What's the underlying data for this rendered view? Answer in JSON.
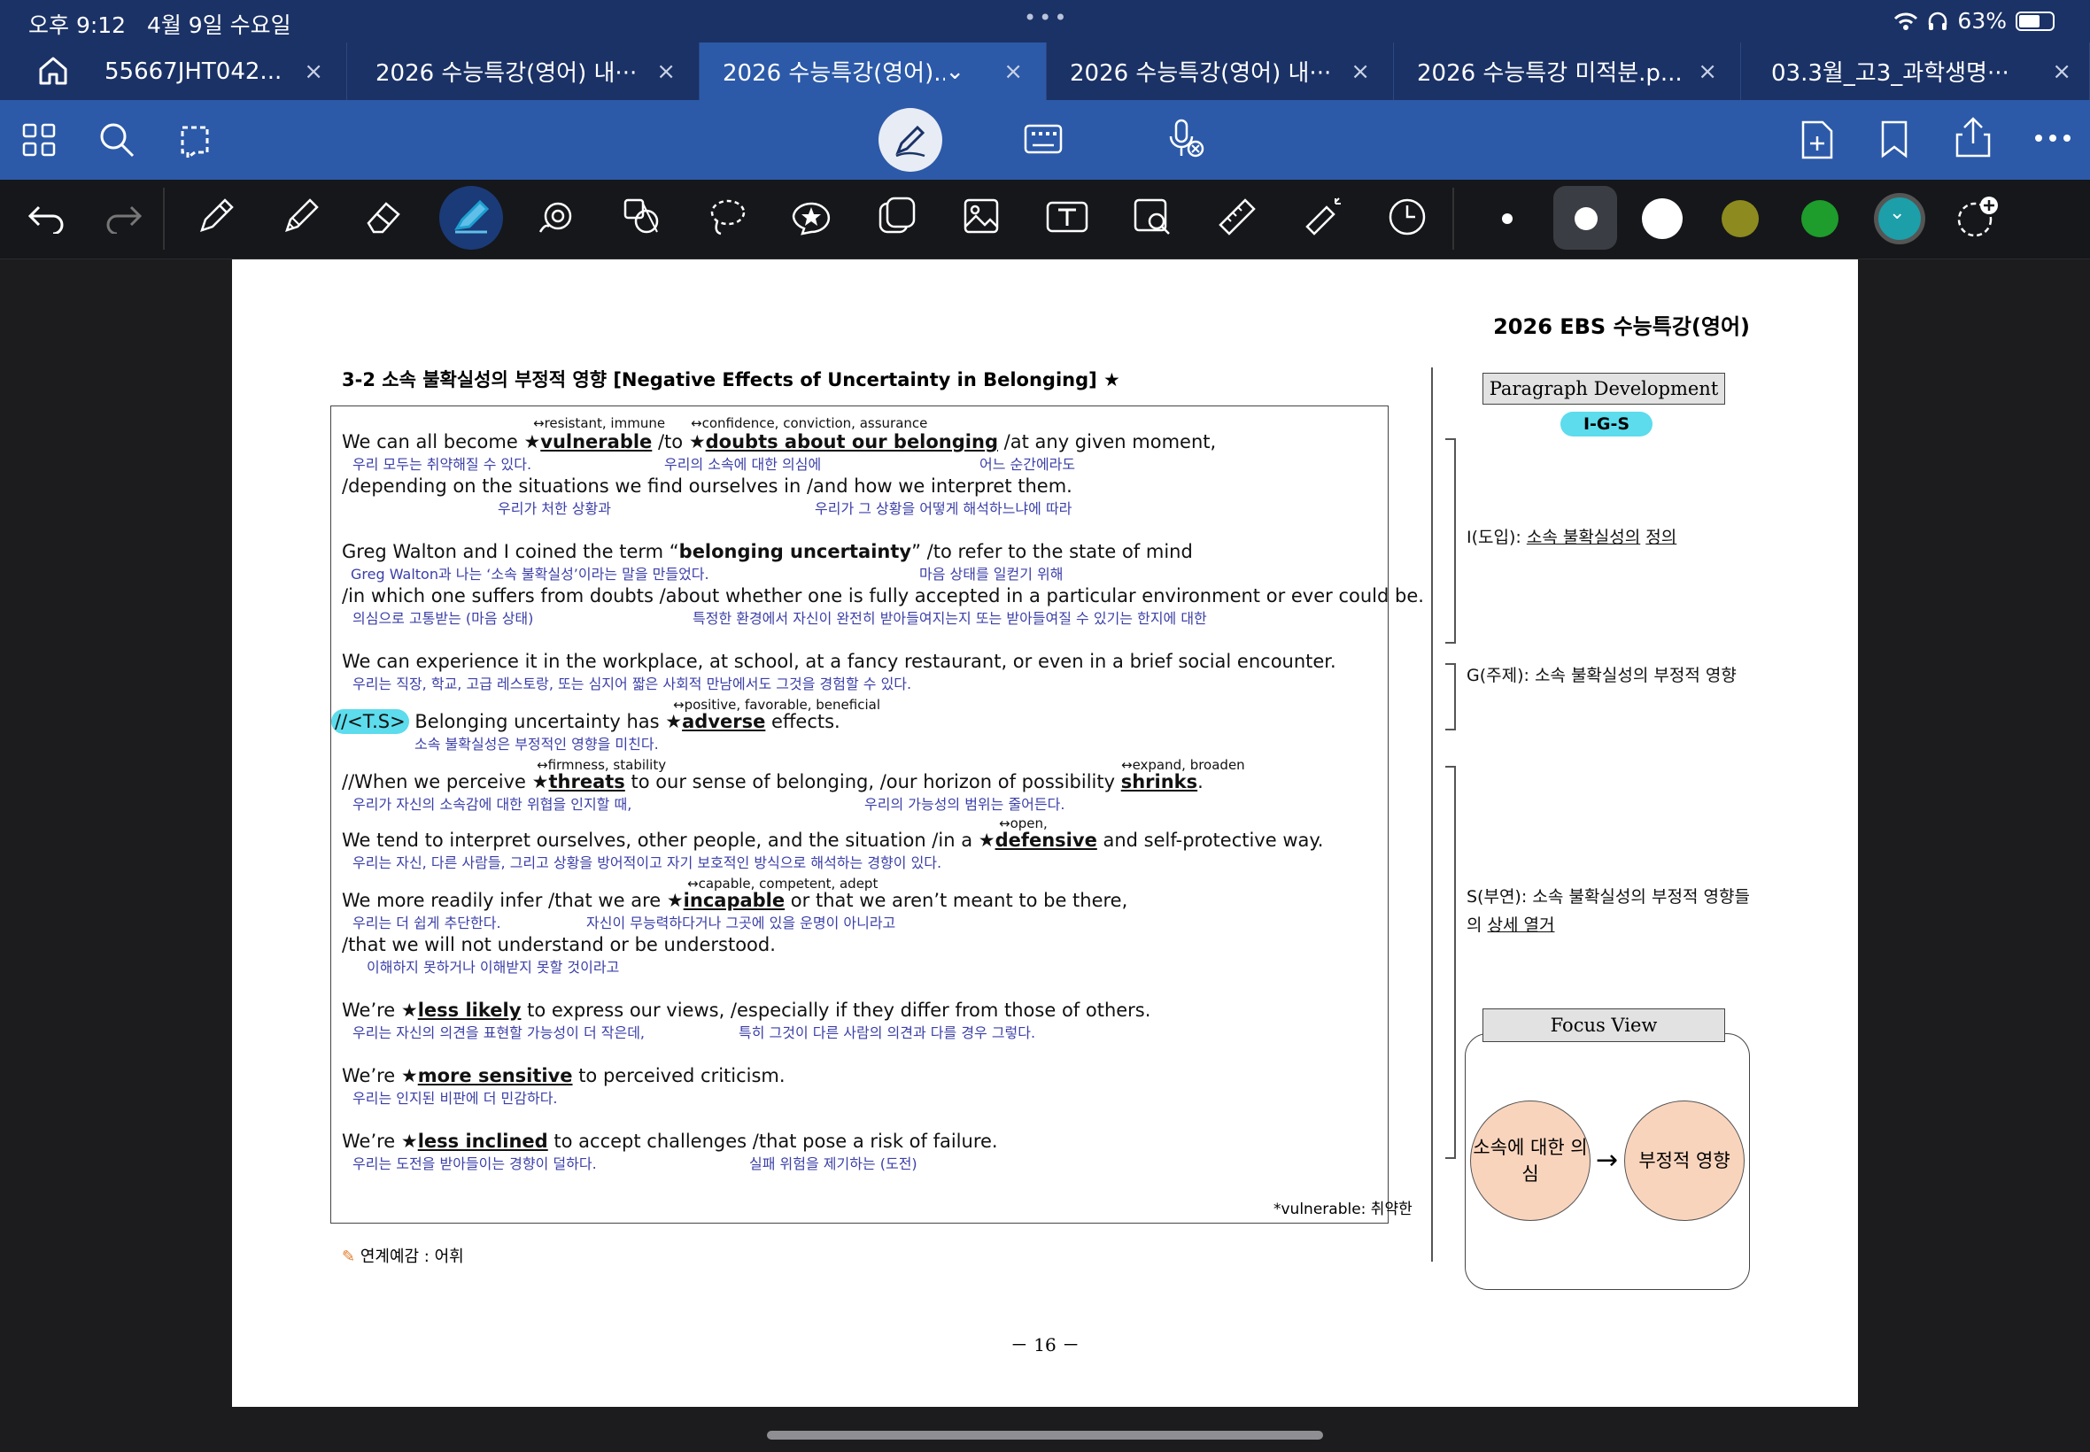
{
  "status": {
    "time": "오후 9:12",
    "date": "4월 9일 수요일",
    "battery": "63%"
  },
  "tabs": [
    {
      "label": "55667JHT042...",
      "active": false
    },
    {
      "label": "2026 수능특강(영어) 내···",
      "active": false
    },
    {
      "label": "2026 수능특강(영어)...",
      "active": true
    },
    {
      "label": "2026 수능특강(영어) 내···",
      "active": false
    },
    {
      "label": "2026 수능특강 미적분.p...",
      "active": false
    },
    {
      "label": "03.3월_고3_과학생명···",
      "active": false
    }
  ],
  "icons": {
    "tab_close": "×",
    "tab_dropdown": "⌄"
  },
  "toolbar_colors": [
    "#ffffff",
    "#ffffff",
    "#ffffff",
    "#8d8a1f",
    "#1e9c2c",
    "#1c9fa8"
  ],
  "doc": {
    "header": "2026  EBS  수능특강(영어)",
    "section_title": "3-2  소속  불확실성의  부정적  영향  [Negative  Effects  of  Uncertainty  in  Belonging]  ★",
    "lines": [
      "We  can  all  become  ",
      "/depending  on  the  situations  we  find  ourselves  in  /and  how  we  interpret  them.",
      "Greg  Walton  and  I  coined  the  term  “",
      "/in  which  one  suffers  from  doubts  /about  whether  one  is  fully  accepted  in  a  particular  environment  or  ever  could  be.",
      "We  can  experience  it  in  the  workplace,  at  school,  at  a  fancy  restaurant,  or  even  in  a  brief  social  encounter.",
      "Belonging  uncertainty  has  ",
      "//When  we  perceive  ",
      "We  tend  to  interpret  ourselves,  other  people,  and  the  situation  /in  a  ",
      "We  more  readily  infer  /that  we  are  ",
      "/that  we  will  not  understand  or  be  understood.",
      "We’re  ",
      "We’re  ",
      "We’re  "
    ],
    "frag": {
      "l1_a": "vulnerable",
      "l1_b": "  /to  ",
      "l1_c": "doubts  about  our  belonging",
      "l1_d": "  /at  any  given  moment,",
      "l3_a": "belonging  uncertainty",
      "l3_b": "”  /to  refer  to  the  state  of  mind",
      "ts": "//<T.S>",
      "l6_a": "adverse",
      "l6_b": "  effects.",
      "l7_a": "threats",
      "l7_b": "  to  our  sense  of  belonging,  /our  horizon  of  possibility  ",
      "l7_c": "shrinks",
      "l8_a": "defensive",
      "l8_b": "  and  self-protective  way.",
      "l9_a": "incapable",
      "l9_b": "  or  that  we  aren’t  meant  to  be  there,",
      "l11_a": "less  likely",
      "l11_b": "  to  express  our  views,  /especially  if  they  differ  from  those  of  others.",
      "l12_a": "more  sensitive",
      "l12_b": "  to  perceived  criticism.",
      "l13_a": "less  inclined",
      "l13_b": "  to  accept  challenges  /that  pose  a  risk  of  failure."
    },
    "above": {
      "a1": "↔resistant,  immune",
      "a2": "↔confidence,  conviction,  assurance",
      "a6": "↔positive,  favorable,  beneficial",
      "a7a": "↔firmness,  stability",
      "a7b": "↔expand,  broaden",
      "a8": "↔open,",
      "a9": "↔capable,  competent,  adept"
    },
    "kr": {
      "k1a": "우리  모두는  취약해질  수  있다.",
      "k1b": "우리의  소속에  대한  의심에",
      "k1c": "어느  순간에라도",
      "k2a": "우리가  처한  상황과",
      "k2b": "우리가  그  상황을  어떻게  해석하느냐에  따라",
      "k3a": "Greg  Walton과  나는  ‘소속  불확실성’이라는  말을  만들었다.",
      "k3b": "마음  상태를  일컫기  위해",
      "k4a": "의심으로  고통받는  (마음  상태)",
      "k4b": "특정한  환경에서  자신이  완전히  받아들여지는지  또는  받아들여질  수  있기는  한지에  대한",
      "k5": "우리는  직장,  학교,  고급  레스토랑,  또는  심지어  짧은  사회적  만남에서도  그것을  경험할  수  있다.",
      "k6": "소속  불확실성은  부정적인  영향을  미친다.",
      "k7a": "우리가  자신의  소속감에  대한  위협을  인지할  때,",
      "k7b": "우리의  가능성의  범위는  줄어든다.",
      "k8": "우리는  자신,  다른  사람들,  그리고  상황을  방어적이고  자기  보호적인  방식으로  해석하는  경향이  있다.",
      "k9a": "우리는  더  쉽게  추단한다.",
      "k9b": "자신이  무능력하다거나  그곳에  있을  운명이  아니라고",
      "k10": "이해하지  못하거나  이해받지  못할  것이라고",
      "k11a": "우리는  자신의  의견을  표현할  가능성이  더  작은데,",
      "k11b": "특히  그것이  다른  사람의  의견과  다를  경우  그렇다.",
      "k12": "우리는  인지된  비판에  더  민감하다.",
      "k13a": "우리는  도전을  받아들이는  경향이  덜하다.",
      "k13b": "실패  위험을  제기하는  (도전)"
    },
    "note": "*vulnerable:  취약한",
    "footer": "연계예감  :  어휘",
    "page": "－  16  －",
    "side": {
      "pd": "Paragraph  Development",
      "igs": "I-G-S",
      "i_pre": "I(도입):  ",
      "i_u1": "소속  불확실성의",
      "i_u2": "정의",
      "g": "G(주제):  소속  불확실성의  부정적  영향",
      "s_pre": "S(부연):  소속  불확실성의  부정적  영향들의  ",
      "s_u": "상세  열거",
      "fv": "Focus  View",
      "ball1": "소속에  대한  의심",
      "arrow": "→",
      "ball2": "부정적  영향"
    }
  }
}
